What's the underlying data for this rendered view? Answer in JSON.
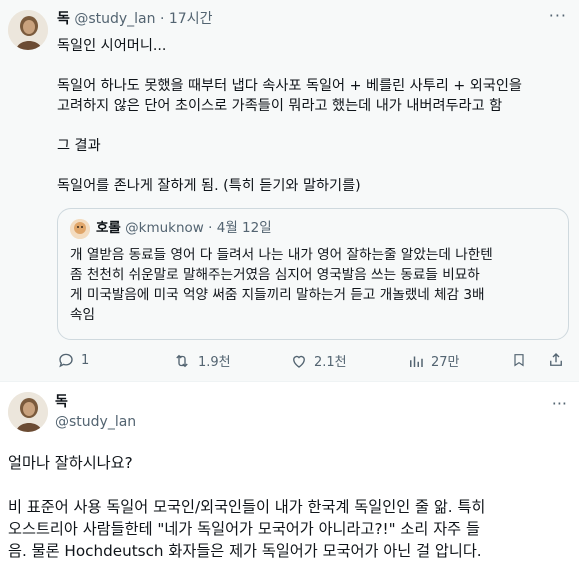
{
  "tweet1": {
    "author_name": "독",
    "handle": "@study_lan",
    "separator": "·",
    "time": "17시간",
    "more": "···",
    "lines": [
      "독일인 시어머니...",
      "",
      "독일어 하나도 못했을 때부터 냅다 속사포 독일어 + 베를린 사투리 + 외국인을",
      "고려하지 않은 단어 초이스로 가족들이 뭐라고 했는데 내가 내버려두라고 함",
      "",
      "그 결과",
      "",
      "독일어를 존나게 잘하게 됨. (특히 듣기와 말하기를)"
    ],
    "quote": {
      "author_name": "호롤",
      "handle": "@kmuknow",
      "separator": "·",
      "date": "4월 12일",
      "lines": [
        "개 열받음 동료들 영어 다 들려서 나는 내가 영어 잘하는줄 알았는데 나한텐",
        "좀 천천히 쉬운말로 말해주는거였음 심지어 영국발음 쓰는 동료들 비묘하",
        "게 미국발음에 미국 억양 써줌 지들끼리 말하는거 듣고 개놀랬네 체감 3배",
        "속임"
      ]
    },
    "actions": {
      "replies": "1",
      "retweets": "1.9천",
      "likes": "2.1천",
      "views": "27만"
    }
  },
  "tweet2": {
    "author_name": "독",
    "handle": "@study_lan",
    "more": "···",
    "lines": [
      "얼마나 잘하시나요?",
      "",
      "비 표준어 사용 독일어 모국인/외국인들이 내가 한국계 독일인인 줄 앎. 특히",
      "오스트리아 사람들한테 \"네가 독일어가 모국어가 아니라고?!\" 소리 자주 들",
      "음. 물론 Hochdeutsch 화자들은 제가 독일어가 모국어가 아닌 걸 압니다."
    ]
  },
  "colors": {
    "text": "#0f1419",
    "secondary": "#536471",
    "border": "#cfd9de",
    "highlight_bg": "#f7f9f9"
  }
}
